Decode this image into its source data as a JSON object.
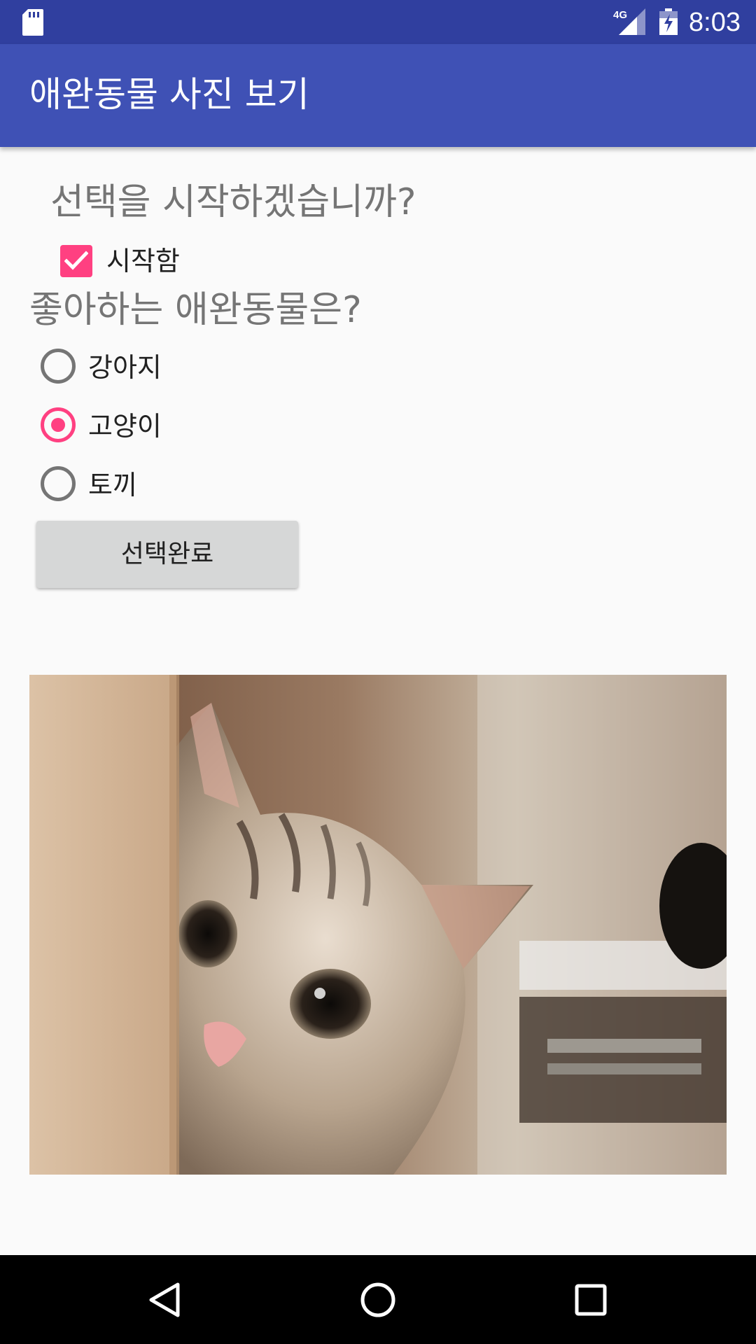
{
  "status_bar": {
    "network": "4G",
    "time": "8:03",
    "icons": [
      "sd-card-icon",
      "signal-icon",
      "battery-charging-icon"
    ]
  },
  "app_bar": {
    "title": "애완동물 사진 보기"
  },
  "main": {
    "start_question": "선택을 시작하겠습니까?",
    "start_checkbox": {
      "label": "시작함",
      "checked": true
    },
    "pet_question": "좋아하는 애완동물은?",
    "pet_options": [
      {
        "label": "강아지",
        "selected": false
      },
      {
        "label": "고양이",
        "selected": true
      },
      {
        "label": "토끼",
        "selected": false
      }
    ],
    "done_button": "선택완료",
    "photo": {
      "subject": "cat-photo"
    }
  },
  "navigation": {
    "buttons": [
      "back-icon",
      "home-icon",
      "recents-icon"
    ]
  },
  "colors": {
    "status_bar": "#303f9f",
    "app_bar": "#3f51b5",
    "accent": "#ff4081",
    "background": "#fafafa"
  }
}
